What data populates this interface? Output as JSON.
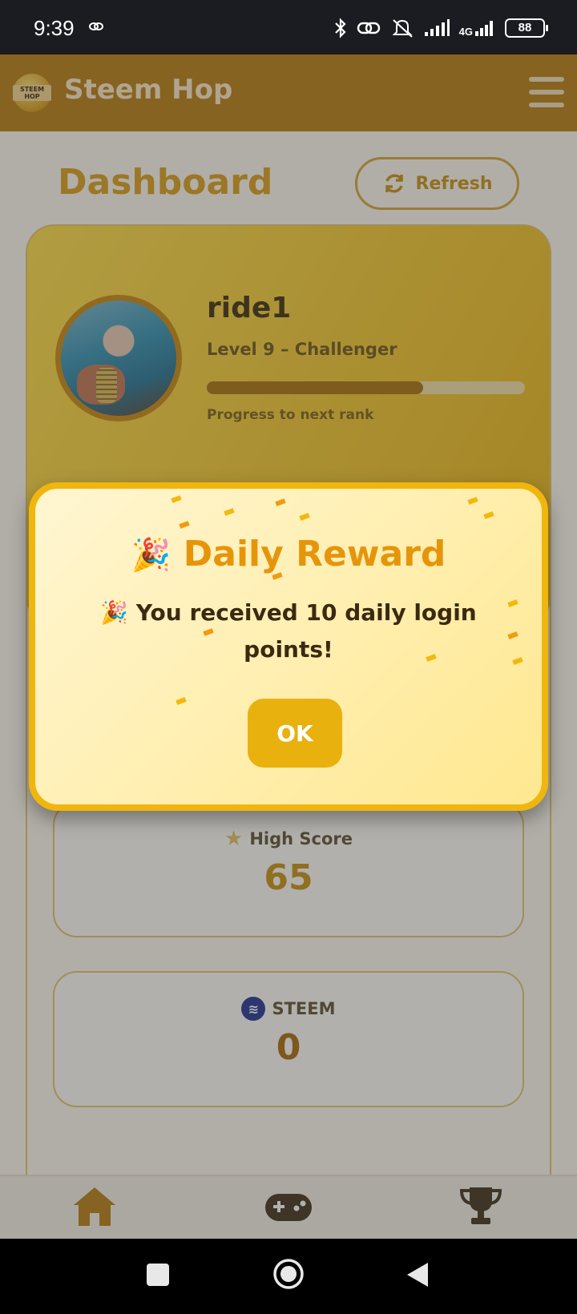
{
  "status_bar": {
    "time": "9:39",
    "network": "4G",
    "battery": "88"
  },
  "app": {
    "title": "Steem Hop",
    "logo_text": "STEEM HOP",
    "brand_color": "#b57906"
  },
  "dashboard": {
    "title": "Dashboard",
    "refresh_label": "Refresh"
  },
  "profile": {
    "username": "ride1",
    "level": "Level 9 – Challenger",
    "progress_label": "Progress to next rank",
    "progress_fraction": 0.68
  },
  "stats": {
    "high_score_label": "High Score",
    "high_score_value": "65",
    "steem_label": "STEEM",
    "steem_value": "0"
  },
  "modal": {
    "title": "Daily Reward",
    "title_emoji": "🎉",
    "message": "🎉 You received 10 daily login points!",
    "ok_label": "OK"
  },
  "icons": {
    "header_menu": "hamburger-icon",
    "refresh": "refresh-icon",
    "high_score": "star-icon",
    "steem": "steem-icon",
    "nav": [
      "home-icon",
      "gamepad-icon",
      "trophy-icon"
    ]
  }
}
